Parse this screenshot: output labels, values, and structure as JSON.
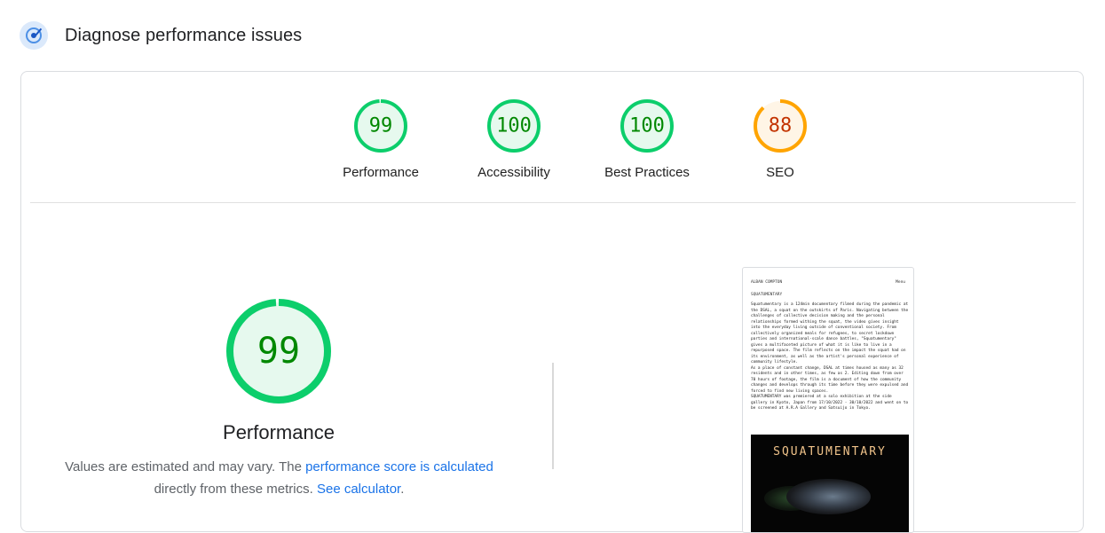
{
  "header": {
    "title": "Diagnose performance issues",
    "icon": "lighthouse-gauge-icon"
  },
  "colors": {
    "pass": "#0cce6b",
    "pass_text": "#008800",
    "pass_fill": "#e6f9ee",
    "average": "#ffa400",
    "average_text": "#c33300",
    "average_fill": "#fff5e6",
    "link": "#1a73e8"
  },
  "gauges": [
    {
      "score": "99",
      "value": 99,
      "label": "Performance",
      "rating": "pass"
    },
    {
      "score": "100",
      "value": 100,
      "label": "Accessibility",
      "rating": "pass"
    },
    {
      "score": "100",
      "value": 100,
      "label": "Best Practices",
      "rating": "pass"
    },
    {
      "score": "88",
      "value": 88,
      "label": "SEO",
      "rating": "average"
    }
  ],
  "performance": {
    "score": "99",
    "value": 99,
    "title": "Performance",
    "note_prefix": "Values are estimated and may vary. The ",
    "note_link": "performance score is calculated",
    "note_middle": " directly from these metrics. ",
    "calc_link": "See calculator",
    "note_suffix": "."
  },
  "screenshot": {
    "site_name": "ALBAN COMPTON",
    "menu": "Menu",
    "heading": "SQUATUMENTARY",
    "body": "Squatumentary is a 124min documentary filmed during the pandemic at the DSAL, a squat on the outskirts of Paris. Navigating between the challenges of collective decision making and the personal relationships formed withing the squat, the video gives insight into the everyday living outside of conventional society. From collectively organized meals for refugees, to secret lockdown parties and international-scale dance battles, \"Squatumentary\" gives a multifaceted picture of what it is like to live in a repurposed space. The film reflects on the impact the squat had on its environment, as well as the artist's personal experience of community lifestyle.\nAs a place of constant change, DSAL at times housed as many as 32 residents and in other times, as few as 2. Editing down from over 70 hours of footage, the film is a document of how the community changes and develops through its time before they were expulsed and forced to find new living spaces.\nSQUATUMENTARY was premiered at a solo exhibition at the side gallery in Kyoto, Japan from 17/10/2022 - 30/10/2022 and went on to be screened at A.R.A Gallery and Satsuijo in Tokyo.",
    "image_title": "SQUATUMENTARY"
  }
}
